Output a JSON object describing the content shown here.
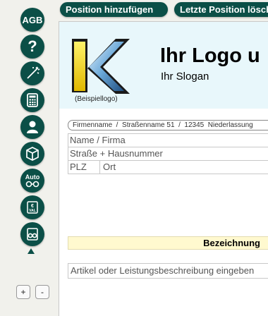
{
  "toolbar": {
    "add_position": "Position hinzufügen",
    "delete_last_position": "Letzte Position lösch"
  },
  "sidebar": {
    "items": [
      {
        "icon": "agb-icon",
        "label": "AGB"
      },
      {
        "icon": "help-icon",
        "label": "?"
      },
      {
        "icon": "wand-icon",
        "label": ""
      },
      {
        "icon": "calculator-icon",
        "label": ""
      },
      {
        "icon": "user-icon",
        "label": ""
      },
      {
        "icon": "box-icon",
        "label": ""
      },
      {
        "icon": "auto-icon",
        "label": "Auto"
      },
      {
        "icon": "currency-icon",
        "label": "€ VAL"
      },
      {
        "icon": "glasses-icon",
        "label": ""
      }
    ],
    "zoom_in": "+",
    "zoom_out": "-"
  },
  "document": {
    "logo_caption": "(Beispiellogo)",
    "logo_title": "Ihr Logo u",
    "slogan": "Ihr Slogan",
    "sender_line": "Firmenname  /  Straßenname 51  /  12345  Niederlassung",
    "address": {
      "name": "Name / Firma",
      "street": "Straße + Hausnummer",
      "plz": "PLZ",
      "city": "Ort"
    },
    "column_header": "Bezeichnung",
    "description_placeholder": "Artikel oder Leistungsbeschreibung eingeben"
  },
  "colors": {
    "accent": "#0b4f47",
    "header_bg": "#e8f7fb",
    "column_header_bg": "#fff9cf",
    "page_bg": "#f1f1ec"
  }
}
